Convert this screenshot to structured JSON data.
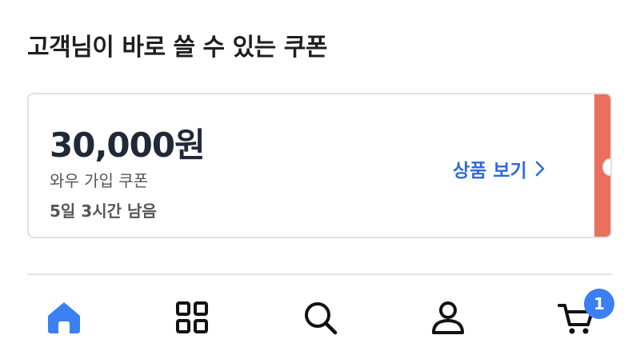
{
  "section": {
    "title": "고객님이 바로 쓸 수 있는 쿠폰"
  },
  "coupon": {
    "amount": "30,000원",
    "name": "와우 가입 쿠폰",
    "remaining": "5일 3시간 남음",
    "action_label": "상품 보기",
    "action_icon": "chevron-right-icon",
    "stripe_color": "#ea6f5e",
    "action_color": "#2e6bd8"
  },
  "bottom_nav": {
    "items": [
      {
        "icon": "home-icon",
        "active": true
      },
      {
        "icon": "category-grid-icon",
        "active": false
      },
      {
        "icon": "search-icon",
        "active": false
      },
      {
        "icon": "user-icon",
        "active": false
      },
      {
        "icon": "cart-icon",
        "active": false
      }
    ],
    "active_color": "#3b7ff0",
    "cart_badge_count": "1"
  }
}
